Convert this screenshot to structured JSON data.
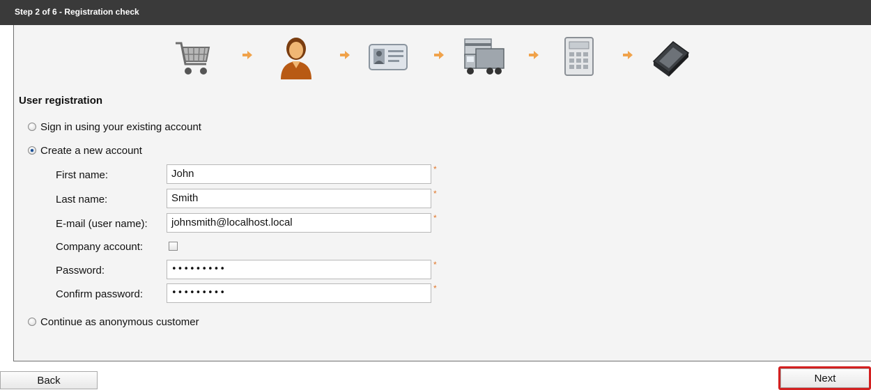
{
  "header": {
    "title": "Step 2 of 6 - Registration check"
  },
  "steps": {
    "icons": [
      "shopping-cart-icon",
      "user-icon",
      "id-card-icon",
      "delivery-truck-icon",
      "calculator-icon",
      "payment-device-icon"
    ],
    "active_index": 1
  },
  "registration": {
    "title": "User registration",
    "options": {
      "sign_in": "Sign in using your existing account",
      "create_new": "Create a new account",
      "anonymous": "Continue as anonymous customer"
    },
    "selected": "create_new",
    "fields": {
      "first_name": {
        "label": "First name:",
        "value": "John"
      },
      "last_name": {
        "label": "Last name:",
        "value": "Smith"
      },
      "email": {
        "label": "E-mail (user name):",
        "value": "johnsmith@localhost.local"
      },
      "company_account": {
        "label": "Company account:",
        "checked": false
      },
      "password": {
        "label": "Password:",
        "value": "•••••••••"
      },
      "confirm_password": {
        "label": "Confirm password:",
        "value": "•••••••••"
      }
    },
    "required_marker": "*"
  },
  "buttons": {
    "back": "Back",
    "next": "Next"
  },
  "colors": {
    "header_bg": "#3a3a3a",
    "required_mark": "#e0762a",
    "highlight": "#d32020",
    "arrow": "#f0a24a"
  }
}
